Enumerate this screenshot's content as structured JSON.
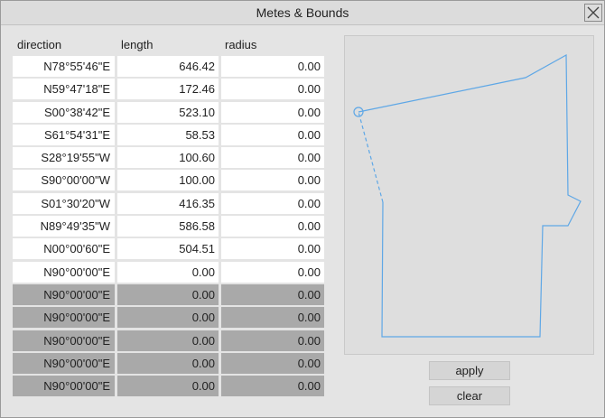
{
  "window": {
    "title": "Metes & Bounds"
  },
  "columns": {
    "direction": "direction",
    "length": "length",
    "radius": "radius"
  },
  "rows": [
    {
      "direction": "N78°55'46\"E",
      "length": "646.42",
      "radius": "0.00",
      "active": true
    },
    {
      "direction": "N59°47'18\"E",
      "length": "172.46",
      "radius": "0.00",
      "active": true
    },
    {
      "direction": "S00°38'42\"E",
      "length": "523.10",
      "radius": "0.00",
      "active": true
    },
    {
      "direction": "S61°54'31\"E",
      "length": "58.53",
      "radius": "0.00",
      "active": true
    },
    {
      "direction": "S28°19'55\"W",
      "length": "100.60",
      "radius": "0.00",
      "active": true
    },
    {
      "direction": "S90°00'00\"W",
      "length": "100.00",
      "radius": "0.00",
      "active": true
    },
    {
      "direction": "S01°30'20\"W",
      "length": "416.35",
      "radius": "0.00",
      "active": true
    },
    {
      "direction": "N89°49'35\"W",
      "length": "586.58",
      "radius": "0.00",
      "active": true
    },
    {
      "direction": "N00°00'60\"E",
      "length": "504.51",
      "radius": "0.00",
      "active": true
    },
    {
      "direction": "N90°00'00\"E",
      "length": "0.00",
      "radius": "0.00",
      "active": true
    },
    {
      "direction": "N90°00'00\"E",
      "length": "0.00",
      "radius": "0.00",
      "active": false
    },
    {
      "direction": "N90°00'00\"E",
      "length": "0.00",
      "radius": "0.00",
      "active": false
    },
    {
      "direction": "N90°00'00\"E",
      "length": "0.00",
      "radius": "0.00",
      "active": false
    },
    {
      "direction": "N90°00'00\"E",
      "length": "0.00",
      "radius": "0.00",
      "active": false
    },
    {
      "direction": "N90°00'00\"E",
      "length": "0.00",
      "radius": "0.00",
      "active": false
    }
  ],
  "buttons": {
    "apply": "apply",
    "clear": "clear"
  },
  "icons": {
    "close": "close-icon",
    "start_point": "start-point-marker"
  },
  "colors": {
    "traverse_line": "#5ea7e6",
    "inactive_row": "#a9a9a9",
    "panel": "#e4e4e4"
  }
}
